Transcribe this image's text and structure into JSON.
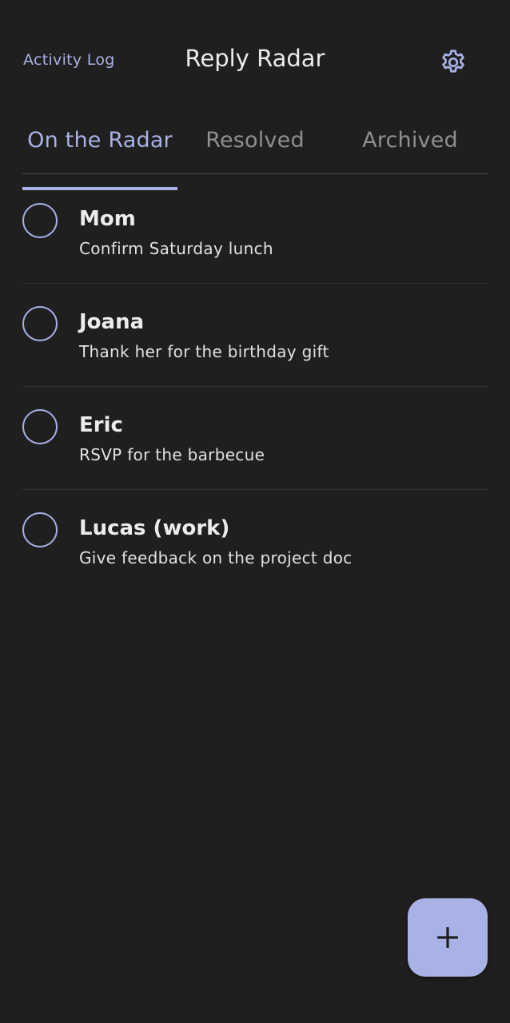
{
  "header": {
    "activity_log_label": "Activity Log",
    "title": "Reply Radar",
    "settings_icon": "gear-icon"
  },
  "tabs": [
    {
      "label": "On the Radar",
      "active": true
    },
    {
      "label": "Resolved",
      "active": false
    },
    {
      "label": "Archived",
      "active": false
    }
  ],
  "items": [
    {
      "name": "Mom",
      "description": "Confirm Saturday lunch"
    },
    {
      "name": "Joana",
      "description": "Thank her for the birthday gift"
    },
    {
      "name": "Eric",
      "description": "RSVP for the barbecue"
    },
    {
      "name": "Lucas (work)",
      "description": "Give feedback on the project doc"
    }
  ],
  "fab": {
    "icon": "plus-icon"
  },
  "colors": {
    "background": "#1f1f1f",
    "accent": "#a9b2e6",
    "text_primary": "#ececec",
    "text_muted": "#8f8f8f"
  }
}
